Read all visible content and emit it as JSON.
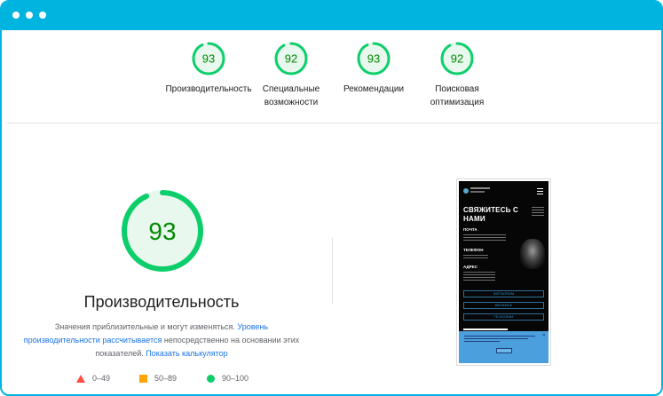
{
  "colors": {
    "frame": "#00b4e0",
    "gauge_stroke": "#0cce6b",
    "gauge_text": "#008800",
    "gauge_fill": "#e8f8ee",
    "poor": "#ff4e42",
    "average": "#ffa400",
    "good": "#0cce6b"
  },
  "summary": [
    {
      "score": 93,
      "label_lines": [
        "Производительность"
      ]
    },
    {
      "score": 92,
      "label_lines": [
        "Специальные",
        "возможности"
      ]
    },
    {
      "score": 93,
      "label_lines": [
        "Рекомендации"
      ]
    },
    {
      "score": 92,
      "label_lines": [
        "Поисковая",
        "оптимизация"
      ]
    }
  ],
  "main": {
    "score": 93,
    "title": "Производительность",
    "desc_1": "Значения приблизительные и могут изменяться.",
    "desc_link_1": "Уровень производительности рассчитывается",
    "desc_2": "непосредственно на основании этих показателей.",
    "desc_link_2": "Показать калькулятор"
  },
  "legend": {
    "poor": "0–49",
    "average": "50–89",
    "good": "90–100"
  },
  "preview": {
    "title": "СВЯЖИТЕСЬ С НАМИ",
    "mail": "ПОЧТА",
    "phone": "ТЕЛЕФОН",
    "address": "АДРЕС",
    "buttons": [
      "INSTAGRAM",
      "BEHANCE",
      "TELEGRAM"
    ]
  }
}
